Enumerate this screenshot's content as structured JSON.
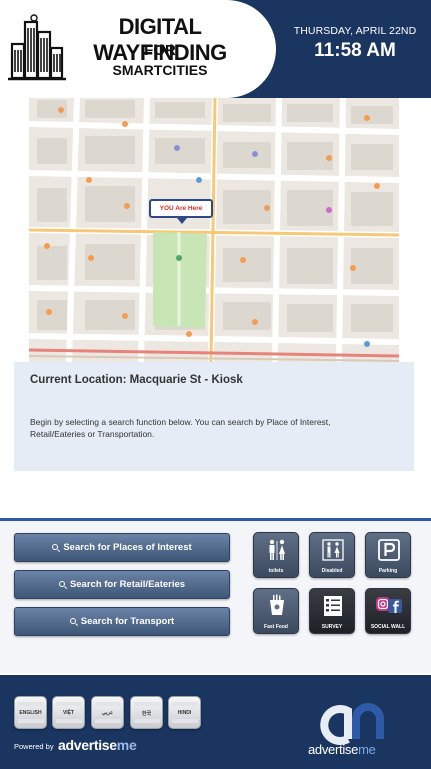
{
  "header": {
    "title_line1": "DIGITAL WAYFINDING",
    "title_line2": "FOR",
    "title_line3": "SMARTCITIES",
    "date": "THURSDAY, APRIL 22ND",
    "time": "11:58 AM",
    "logo_icon": "city-buildings-icon",
    "colors": {
      "header_bg": "#1b3561"
    }
  },
  "map": {
    "you_are_here": "YOU Are Here"
  },
  "info": {
    "current_location": "Current Location: Macquarie St - Kiosk",
    "instructions": "Begin by selecting a search function below. You can search by Place of Interest, Retail/Eateries or Transportation."
  },
  "search": {
    "buttons": [
      {
        "label": "Search for Places of Interest",
        "icon": "search-icon"
      },
      {
        "label": "Search for Retail/Eateries",
        "icon": "search-icon"
      },
      {
        "label": "Search for Transport",
        "icon": "search-icon"
      }
    ],
    "tiles": [
      {
        "label": "toilets",
        "icon": "toilets-icon"
      },
      {
        "label": "Disabled",
        "icon": "disabled-toilet-icon"
      },
      {
        "label": "Parking",
        "icon": "parking-icon"
      },
      {
        "label": "Fast Food",
        "icon": "fast-food-icon"
      },
      {
        "label": "SURVEY",
        "icon": "survey-icon"
      },
      {
        "label": "SOCIAL WALL",
        "icon": "social-wall-icon"
      }
    ]
  },
  "footer": {
    "languages": [
      {
        "label": "ENGLISH"
      },
      {
        "label": "VIỆT"
      },
      {
        "label": "عربي"
      },
      {
        "label": "한국"
      },
      {
        "label": "HINDI"
      }
    ],
    "powered_by": "Powered by",
    "powered_brand_a": "advertise",
    "powered_brand_b": "me",
    "brand_a": "advertise",
    "brand_b": "me",
    "colors": {
      "footer_bg": "#1b3561",
      "accent": "#2d5ba8"
    }
  }
}
